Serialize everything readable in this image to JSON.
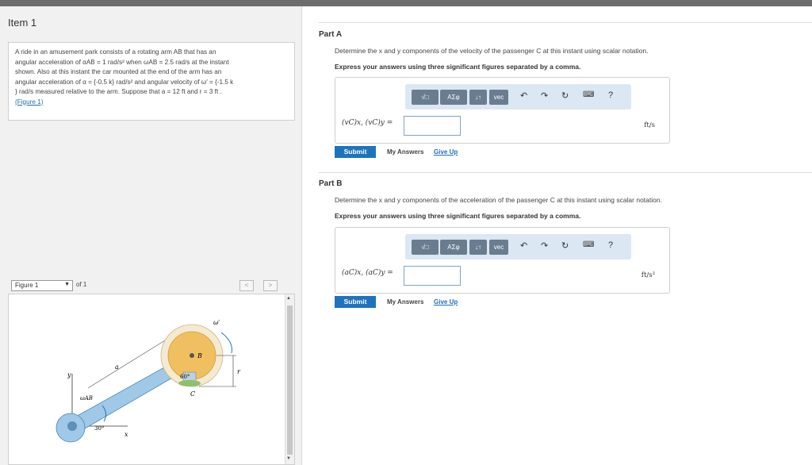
{
  "item": {
    "title": "Item 1"
  },
  "problem": {
    "line1": "A ride in an amusement park consists of a rotating arm AB that has an",
    "line2": "angular acceleration of αAB = 1 rad/s² when ωAB = 2.5 rad/s at the instant",
    "line3": "shown. Also at this instant the car mounted at the end of the arm has an",
    "line4": "angular acceleration of α = {-0.5 k} rad/s² and angular velocity of ω′ = {-1.5 k",
    "line5": "} rad/s measured relative to the arm. Suppose that a = 12 ft and r = 3 ft .",
    "link": "(Figure 1)"
  },
  "figure_nav": {
    "select": "Figure 1",
    "of": "of 1",
    "prev": "<",
    "next": ">"
  },
  "figure": {
    "labels": {
      "omega_prime": "ω′",
      "B": "B",
      "r": "r",
      "a": "a",
      "y": "y",
      "omegaAB": "ωAB",
      "angle30": "30°",
      "angle60": "60°",
      "C": "C",
      "x": "x"
    }
  },
  "partA": {
    "title": "Part A",
    "question": "Determine the x and y components of the velocity of the passenger C at this instant using scalar notation.",
    "instruction": "Express your answers using three significant figures separated by a comma.",
    "expr": "(vC)x, (vC)y =",
    "unit": "ft/s",
    "submit": "Submit",
    "my_answers": "My Answers",
    "give_up": "Give Up"
  },
  "partB": {
    "title": "Part B",
    "question": "Determine the x and y components of the acceleration of the passenger C at this instant using scalar notation.",
    "instruction": "Express your answers using three significant figures separated by a comma.",
    "expr": "(aC)x, (aC)y =",
    "unit": "ft/s²",
    "submit": "Submit",
    "my_answers": "My Answers",
    "give_up": "Give Up"
  },
  "toolbar": {
    "templates_label": "√□",
    "symbols_label": "ΑΣφ",
    "updown_label": "↓↑",
    "vec_label": "vec",
    "help_label": "?",
    "icons": [
      "templates-icon",
      "undo-icon",
      "redo-icon",
      "reset-icon",
      "keyboard-icon",
      "help-icon"
    ]
  },
  "colors": {
    "submit_bg": "#1e73be",
    "toolbar_bg": "#dbe7f3",
    "tool_button": "#6a7d90",
    "link": "#1e6fb8",
    "arm": "#9fc9e6",
    "car": "#f0c060"
  }
}
